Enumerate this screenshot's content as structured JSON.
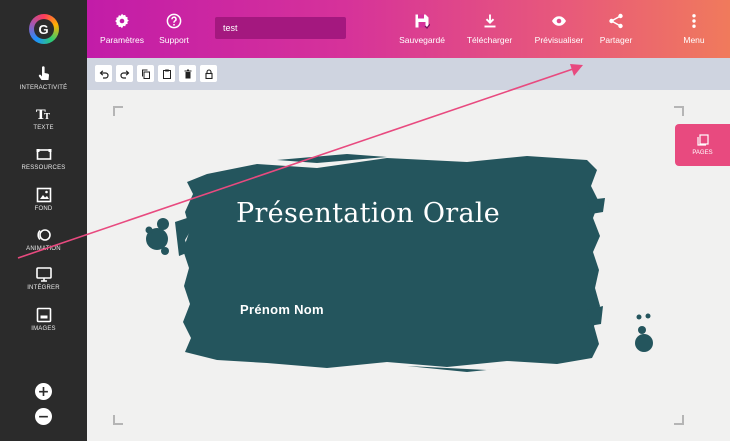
{
  "sidebar": {
    "logo": "genially-logo",
    "items": [
      {
        "label": "INTERACTIVITÉ",
        "icon": "hand-pointer-icon"
      },
      {
        "label": "TEXTE",
        "icon": "text-icon"
      },
      {
        "label": "RESSOURCES",
        "icon": "resources-icon"
      },
      {
        "label": "FOND",
        "icon": "background-icon"
      },
      {
        "label": "ANIMATION",
        "icon": "animation-icon"
      },
      {
        "label": "INTÉGRER",
        "icon": "embed-icon"
      },
      {
        "label": "IMAGES",
        "icon": "image-icon"
      }
    ],
    "zoom_in": "+",
    "zoom_out": "−"
  },
  "topbar": {
    "settings_label": "Paramètres",
    "support_label": "Support",
    "title_value": "test",
    "saved_label": "Sauvegardé",
    "download_label": "Télécharger",
    "preview_label": "Prévisualiser",
    "share_label": "Partager",
    "menu_label": "Menu"
  },
  "toolbar": {
    "tools": [
      "undo-icon",
      "redo-icon",
      "copy-icon",
      "paste-icon",
      "delete-icon",
      "lock-icon"
    ]
  },
  "slide": {
    "title": "Présentation Orale",
    "subtitle": "Prénom Nom"
  },
  "pages_tab": {
    "label": "PAGES"
  },
  "colors": {
    "brush": "#24555d",
    "sidebar": "#2b2b2b",
    "topbar_start": "#c21ca8",
    "topbar_end": "#f07a5c",
    "pages_tab": "#e84a7f",
    "annotation_arrow": "#e84a7f"
  }
}
